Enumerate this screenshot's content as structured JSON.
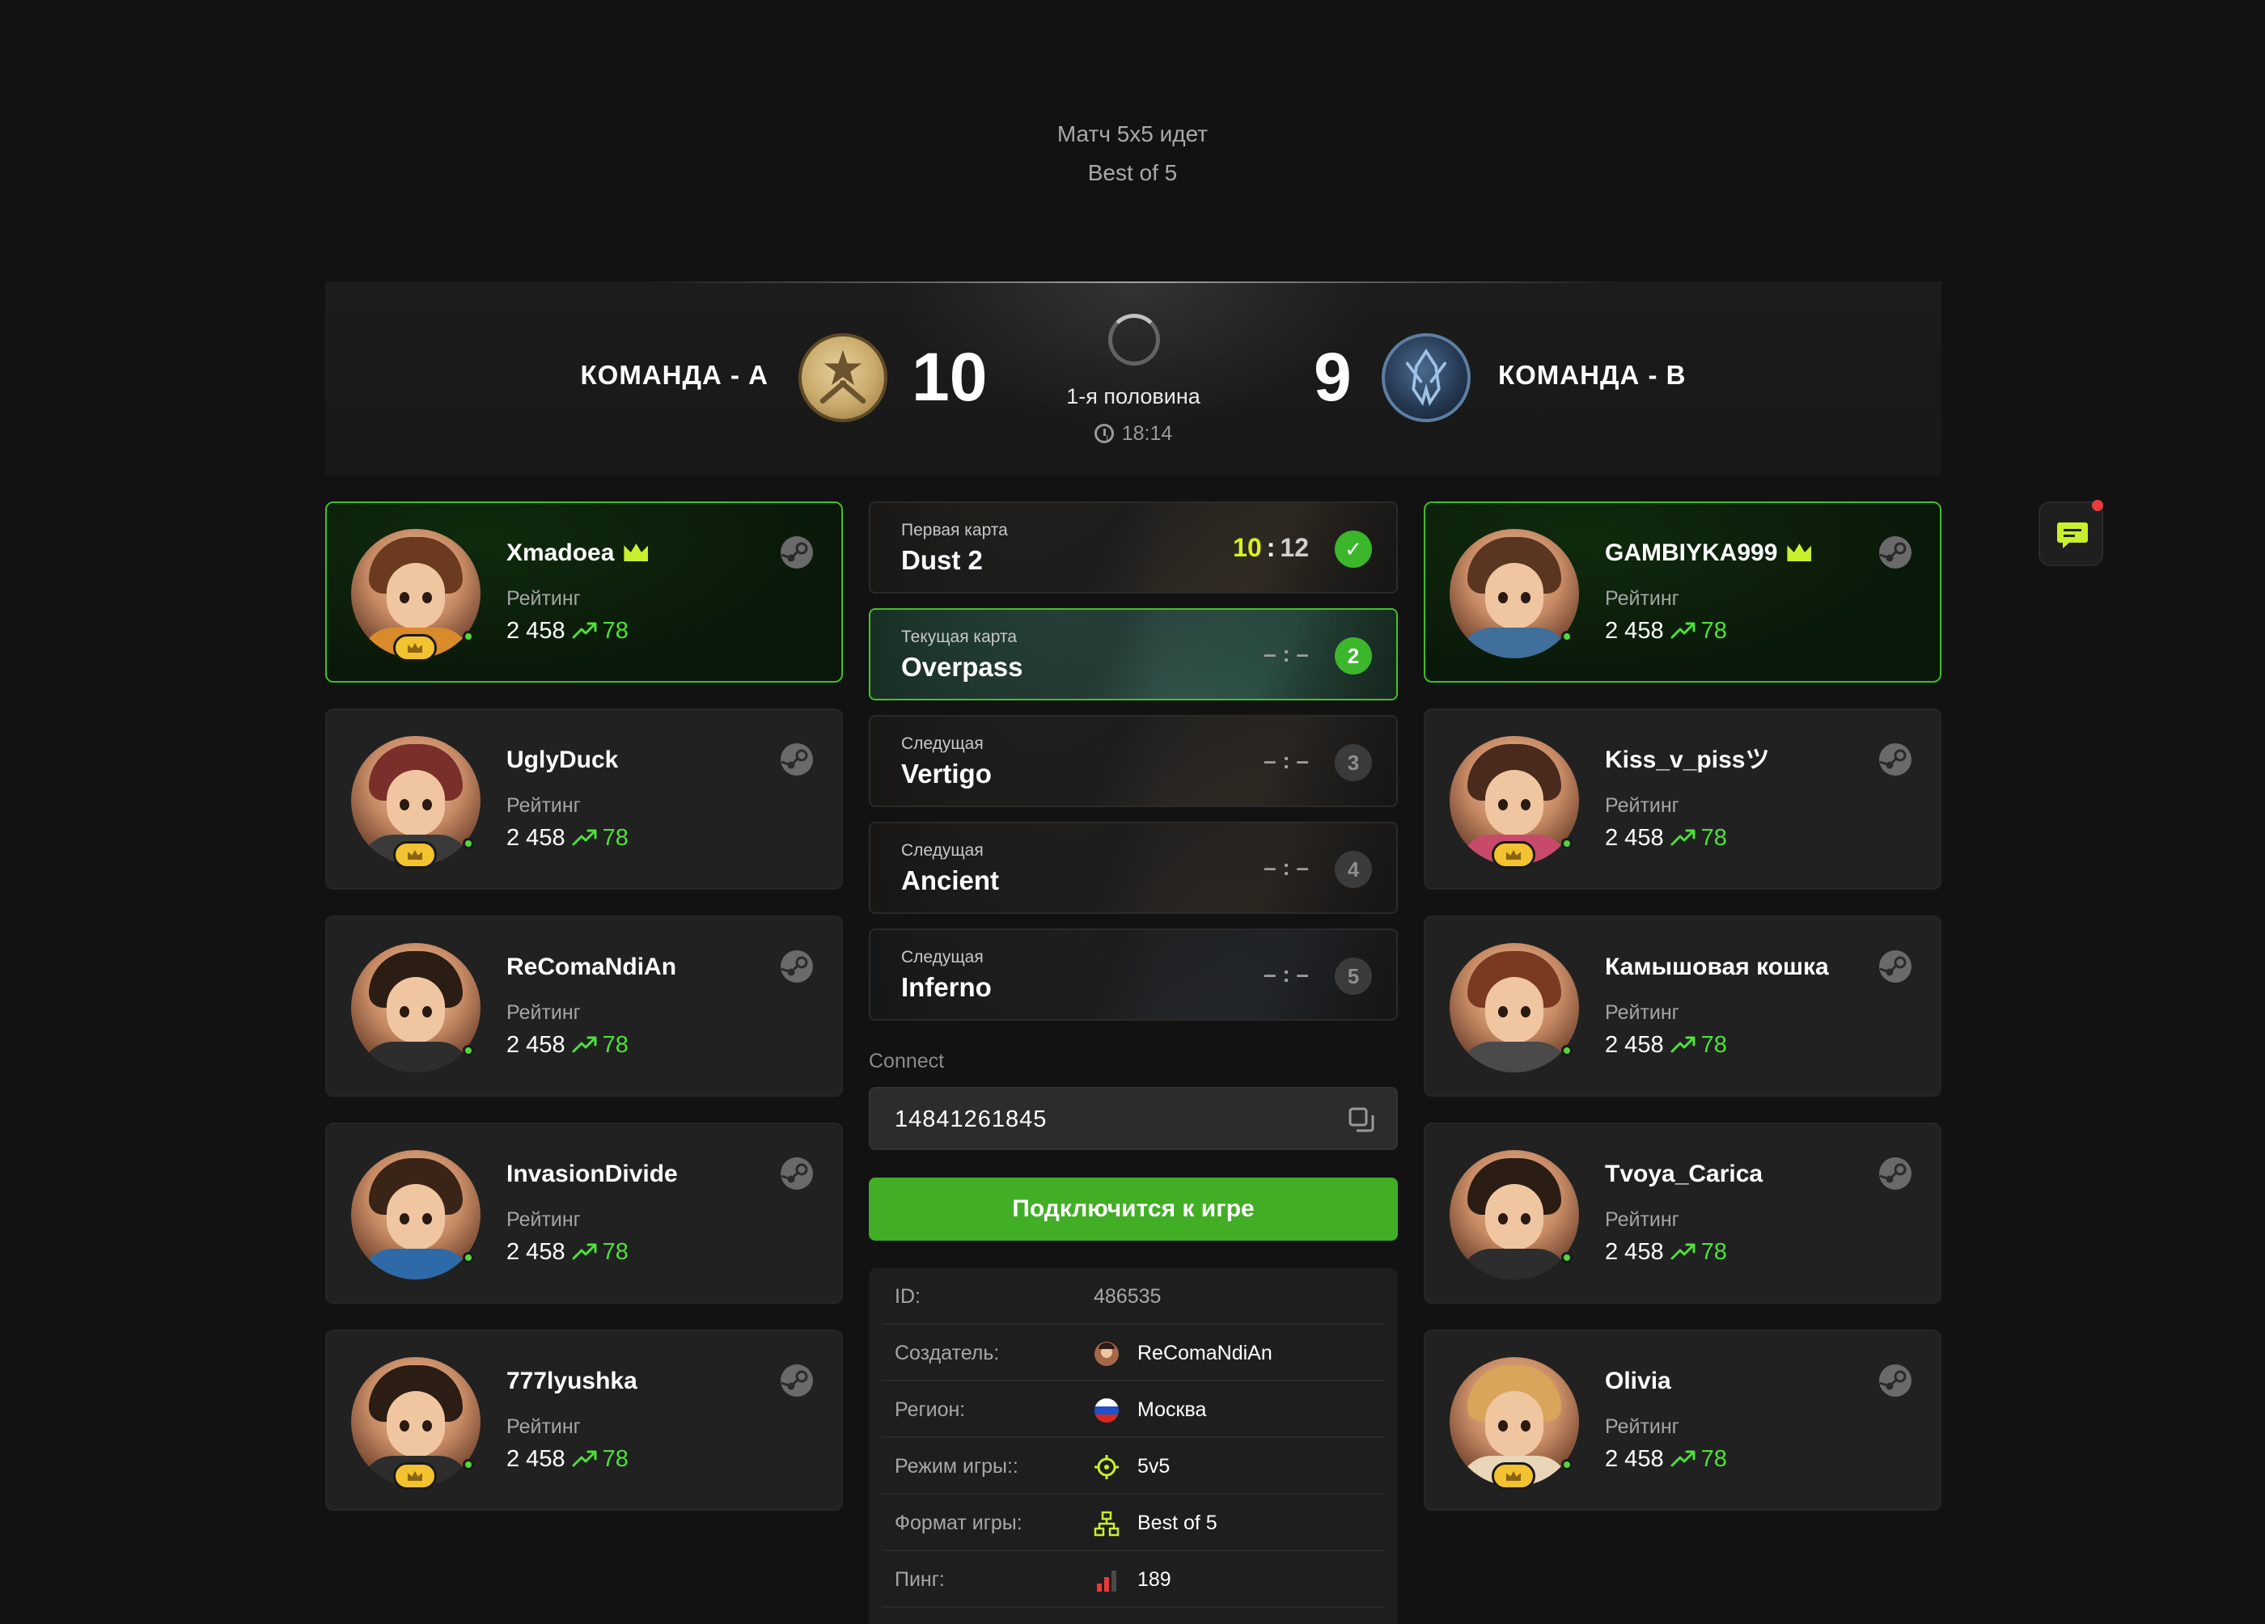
{
  "header": {
    "status": "Матч 5x5 идет",
    "format": "Best of 5"
  },
  "scoreboard": {
    "team_a": {
      "name": "КОМАНДА - A",
      "score": "10",
      "logo": "terrorist-logo"
    },
    "team_b": {
      "name": "КОМАНДА - B",
      "score": "9",
      "logo": "counter-terrorist-logo"
    },
    "half": "1-я половина",
    "time": "18:14"
  },
  "rating_label": "Рейтинг",
  "team_a_players": [
    {
      "name": "Xmadoea",
      "rating": "2 458",
      "delta": "78",
      "captain": true,
      "badge": true,
      "hair": "#6b3a1f",
      "shirt": "#d98a2b"
    },
    {
      "name": "UglyDuck",
      "rating": "2 458",
      "delta": "78",
      "captain": false,
      "badge": true,
      "hair": "#7a2f2a",
      "shirt": "#3a3a3a"
    },
    {
      "name": "ReComaNdiAn",
      "rating": "2 458",
      "delta": "78",
      "captain": false,
      "badge": false,
      "hair": "#2b1c14",
      "shirt": "#2d2d2d"
    },
    {
      "name": "InvasionDivide",
      "rating": "2 458",
      "delta": "78",
      "captain": false,
      "badge": false,
      "hair": "#3a2417",
      "shirt": "#2f6aa8"
    },
    {
      "name": "777lyushka",
      "rating": "2 458",
      "delta": "78",
      "captain": false,
      "badge": true,
      "hair": "#2b1c14",
      "shirt": "#2d2d2d"
    }
  ],
  "team_b_players": [
    {
      "name": "GAMBIYKA999",
      "rating": "2 458",
      "delta": "78",
      "captain": true,
      "badge": false,
      "hair": "#5a3520",
      "shirt": "#3f6f9a"
    },
    {
      "name": "Kiss_v_pissツ",
      "rating": "2 458",
      "delta": "78",
      "captain": false,
      "badge": true,
      "hair": "#4a2a1c",
      "shirt": "#c84a6a"
    },
    {
      "name": "Камышовая кошка",
      "rating": "2 458",
      "delta": "78",
      "captain": false,
      "badge": false,
      "hair": "#7a3a22",
      "shirt": "#4a4a4a"
    },
    {
      "name": "Tvoya_Carica",
      "rating": "2 458",
      "delta": "78",
      "captain": false,
      "badge": false,
      "hair": "#2b1c14",
      "shirt": "#2d2d2d"
    },
    {
      "name": "Olivia",
      "rating": "2 458",
      "delta": "78",
      "captain": false,
      "badge": true,
      "hair": "#d9a55a",
      "shirt": "#e9d5b8"
    }
  ],
  "maps": [
    {
      "label": "Первая карта",
      "name": "Dust 2",
      "score_a": "10",
      "score_b": "12",
      "state": "done",
      "status": "✓",
      "bg": "#6b5a3e"
    },
    {
      "label": "Текущая карта",
      "name": "Overpass",
      "score": "– : –",
      "state": "now",
      "status": "2",
      "bg": "#4d7a6e"
    },
    {
      "label": "Следущая",
      "name": "Vertigo",
      "score": "– : –",
      "state": "next",
      "status": "3",
      "bg": "#5e5240"
    },
    {
      "label": "Следущая",
      "name": "Ancient",
      "score": "– : –",
      "state": "next",
      "status": "4",
      "bg": "#5a4a3a"
    },
    {
      "label": "Следущая",
      "name": "Inferno",
      "score": "– : –",
      "state": "next",
      "status": "5",
      "bg": "#3e4a5a"
    }
  ],
  "connect": {
    "label": "Connect",
    "value": "14841261845",
    "button": "Подключится к игре"
  },
  "info": {
    "id_key": "ID:",
    "id_val": "486535",
    "creator_key": "Создатель:",
    "creator_val": "ReComaNdiAn",
    "region_key": "Регион:",
    "region_val": "Москва",
    "mode_key": "Режим игры::",
    "mode_val": "5v5",
    "format_key": "Формат игры:",
    "format_val": "Best of 5",
    "ping_key": "Пинг:",
    "ping_val": "189"
  },
  "colors": {
    "accent": "#42ae25",
    "delta": "#4fe03a",
    "crown": "#c9f02d",
    "score_win": "#d7f11f"
  }
}
